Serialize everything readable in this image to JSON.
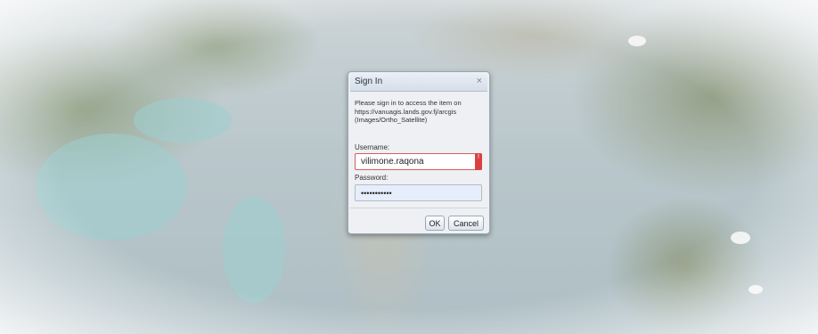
{
  "dialog": {
    "title": "Sign In",
    "close_symbol": "×",
    "message_line1": "Please sign in to access the item on",
    "message_line2": "https://vanuagis.lands.gov.fj/arcgis",
    "message_line3": "(Images/Ortho_Satellite)",
    "username_label": "Username:",
    "username_value": "vilimone.raqona",
    "password_label": "Password:",
    "password_value": "•••••••••••",
    "warning_symbol": "!",
    "ok_label": "OK",
    "cancel_label": "Cancel"
  },
  "icons": {
    "close": "close-icon",
    "warning": "warning-icon"
  },
  "colors": {
    "warning_red": "#d94141",
    "password_fill": "#e6eefb"
  }
}
